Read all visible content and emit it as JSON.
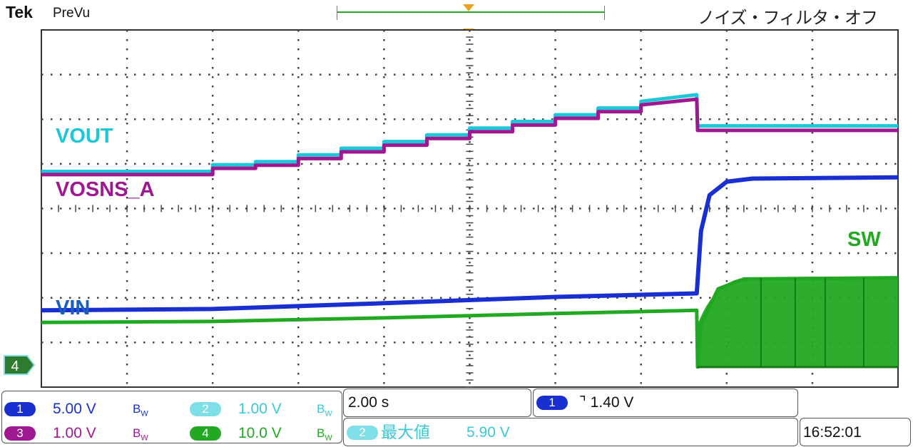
{
  "header": {
    "brand": "Tek",
    "mode": "PreVu",
    "noise_filter": "ノイズ・フィルタ・オフ"
  },
  "traces": {
    "vout_label": "VOUT",
    "vosns_label": "VOSNS_A",
    "vin_label": "VIN",
    "sw_label": "SW",
    "ground_marker": "4"
  },
  "channels": {
    "ch1": {
      "num": "1",
      "scale": "5.00 V",
      "bw": "B",
      "bw_sub": "W",
      "color": "#1a2fd0"
    },
    "ch2": {
      "num": "2",
      "scale": "1.00 V",
      "bw": "B",
      "bw_sub": "W",
      "color": "#7fdfe8"
    },
    "ch3": {
      "num": "3",
      "scale": "1.00 V",
      "bw": "B",
      "bw_sub": "W",
      "color": "#a0188f"
    },
    "ch4": {
      "num": "4",
      "scale": "10.0 V",
      "bw": "B",
      "bw_sub": "W",
      "color": "#22a822"
    }
  },
  "timebase": "2.00 s",
  "trigger": {
    "channel": "1",
    "text": "⌝ 1.40 V"
  },
  "measurement": {
    "channel": "2",
    "text": "最大値",
    "value": "5.90 V"
  },
  "clock": "16:52:01",
  "chart_data": {
    "type": "line",
    "title": "",
    "xlabel": "",
    "ylabel": "",
    "grid": true,
    "xlim": [
      0,
      10
    ],
    "ylim": [
      0,
      8
    ],
    "x_unit_note": "horizontal divisions",
    "series": [
      {
        "name": "VOUT",
        "color": "#1cc8d8",
        "points": [
          [
            0,
            4.83
          ],
          [
            1.8,
            4.83
          ],
          [
            2.0,
            4.98
          ],
          [
            2.5,
            5.05
          ],
          [
            3.0,
            5.2
          ],
          [
            3.5,
            5.35
          ],
          [
            4.0,
            5.5
          ],
          [
            4.5,
            5.65
          ],
          [
            5.0,
            5.8
          ],
          [
            5.5,
            5.95
          ],
          [
            6.0,
            6.1
          ],
          [
            6.5,
            6.25
          ],
          [
            7.0,
            6.4
          ],
          [
            7.65,
            6.55
          ],
          [
            7.66,
            5.85
          ],
          [
            10,
            5.85
          ]
        ]
      },
      {
        "name": "VOSNS_A",
        "color": "#a0188f",
        "points": [
          [
            0,
            4.76
          ],
          [
            1.8,
            4.76
          ],
          [
            2.0,
            4.9
          ],
          [
            2.5,
            4.97
          ],
          [
            3.0,
            5.12
          ],
          [
            3.5,
            5.27
          ],
          [
            4.0,
            5.42
          ],
          [
            4.5,
            5.57
          ],
          [
            5.0,
            5.72
          ],
          [
            5.5,
            5.87
          ],
          [
            6.0,
            6.02
          ],
          [
            6.5,
            6.17
          ],
          [
            7.0,
            6.32
          ],
          [
            7.65,
            6.45
          ],
          [
            7.66,
            5.75
          ],
          [
            10,
            5.75
          ]
        ]
      },
      {
        "name": "VIN",
        "color": "#1a2fd0",
        "points": [
          [
            0,
            1.72
          ],
          [
            2.0,
            1.75
          ],
          [
            4.0,
            1.88
          ],
          [
            6.0,
            2.02
          ],
          [
            7.65,
            2.1
          ],
          [
            7.7,
            3.5
          ],
          [
            7.8,
            4.3
          ],
          [
            8.0,
            4.6
          ],
          [
            8.3,
            4.67
          ],
          [
            10,
            4.7
          ]
        ]
      },
      {
        "name": "SW",
        "color": "#22a822",
        "points": [
          [
            0,
            1.45
          ],
          [
            2.0,
            1.47
          ],
          [
            4.0,
            1.55
          ],
          [
            6.0,
            1.65
          ],
          [
            7.65,
            1.72
          ],
          [
            7.66,
            0.45
          ],
          [
            7.7,
            1.4
          ],
          [
            7.9,
            2.2
          ],
          [
            8.2,
            2.42
          ],
          [
            10,
            2.45
          ]
        ]
      }
    ]
  }
}
